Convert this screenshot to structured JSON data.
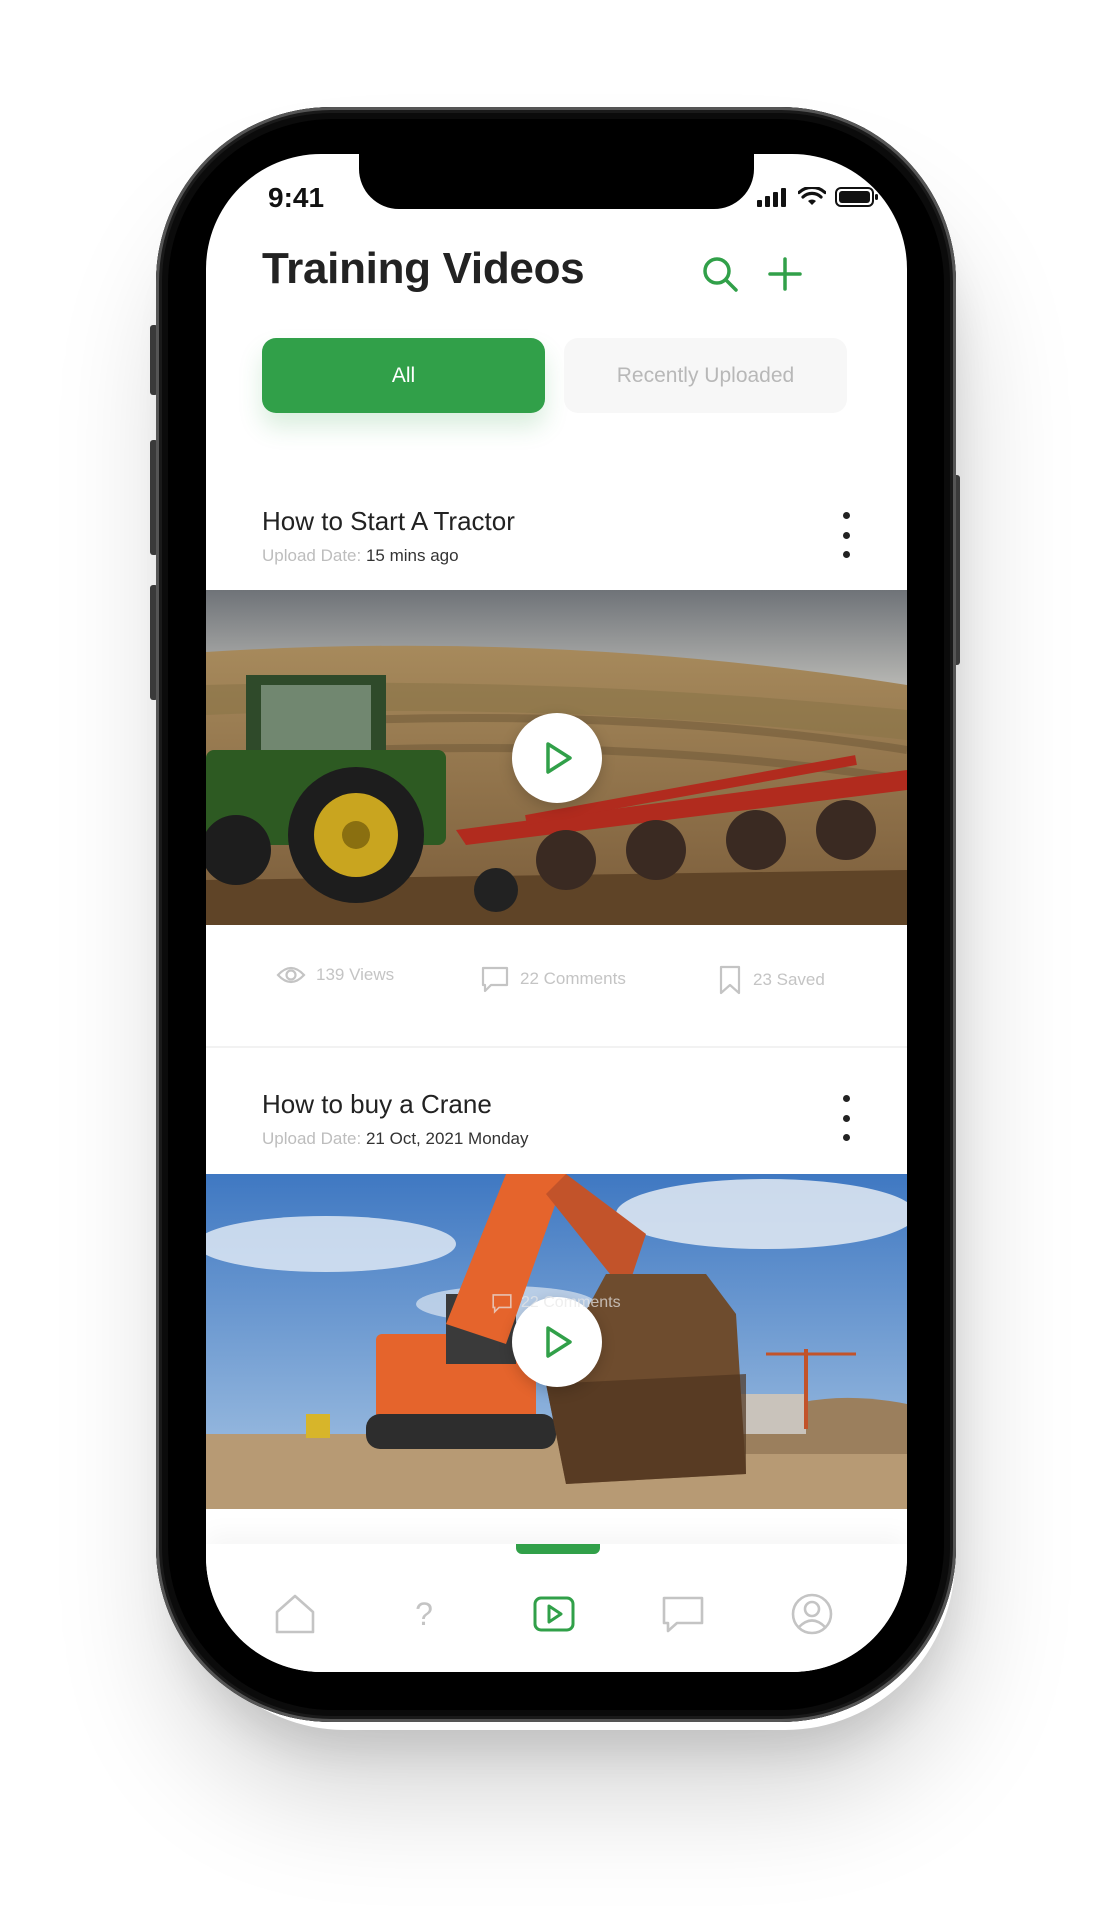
{
  "status_bar": {
    "time": "9:41"
  },
  "header": {
    "title": "Training Videos"
  },
  "tabs": [
    {
      "label": "All",
      "active": true
    },
    {
      "label": "Recently Uploaded",
      "active": false
    }
  ],
  "videos": [
    {
      "title": "How to Start A Tractor",
      "upload_label": "Upload Date:",
      "upload_date": "15 mins ago",
      "stats": {
        "views": "139 Views",
        "comments": "22 Comments",
        "saved": "23 Saved"
      }
    },
    {
      "title": "How to buy a Crane",
      "upload_label": "Upload Date:",
      "upload_date": "21 Oct, 2021 Monday",
      "overlay_text": "22 Comments"
    }
  ],
  "bottom_nav": {
    "items": [
      "home-icon",
      "help-icon",
      "video-icon",
      "chat-icon",
      "profile-icon"
    ],
    "help_glyph": "?",
    "active": "video-icon"
  },
  "colors": {
    "accent": "#31a049",
    "muted": "#c4c4c4",
    "text": "#222222"
  }
}
